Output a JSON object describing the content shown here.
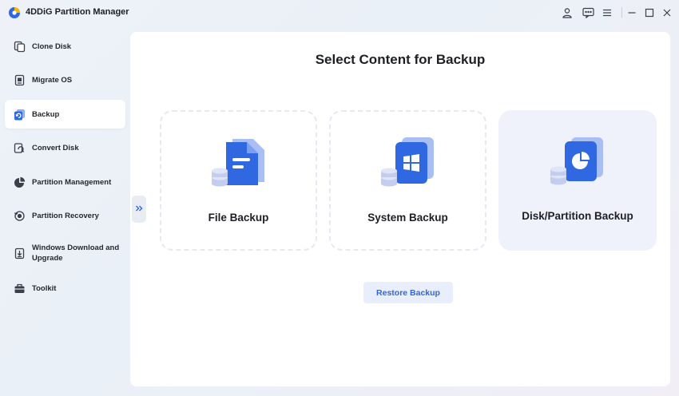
{
  "app": {
    "title": "4DDiG Partition Manager"
  },
  "titlebar": {
    "icons": [
      "account-icon",
      "feedback-icon",
      "menu-icon",
      "minimize-icon",
      "maximize-icon",
      "close-icon"
    ]
  },
  "sidebar": {
    "items": [
      {
        "label": "Clone Disk",
        "icon": "clone-disk-icon",
        "active": false
      },
      {
        "label": "Migrate OS",
        "icon": "migrate-os-icon",
        "active": false
      },
      {
        "label": "Backup",
        "icon": "backup-icon",
        "active": true
      },
      {
        "label": "Convert Disk",
        "icon": "convert-disk-icon",
        "active": false
      },
      {
        "label": "Partition Management",
        "icon": "partition-management-icon",
        "active": false
      },
      {
        "label": "Partition Recovery",
        "icon": "partition-recovery-icon",
        "active": false
      },
      {
        "label": "Windows Download and Upgrade",
        "icon": "windows-download-icon",
        "active": false
      },
      {
        "label": "Toolkit",
        "icon": "toolkit-icon",
        "active": false
      }
    ]
  },
  "main": {
    "title": "Select Content for Backup",
    "cards": [
      {
        "label": "File Backup",
        "icon": "file-backup-icon",
        "selected": false
      },
      {
        "label": "System Backup",
        "icon": "system-backup-icon",
        "selected": false
      },
      {
        "label": "Disk/Partition Backup",
        "icon": "disk-partition-backup-icon",
        "selected": true
      }
    ],
    "restore_label": "Restore Backup"
  },
  "colors": {
    "accent": "#2f68e0",
    "active_nav_icon": "#2d6be4",
    "selected_card_bg": "#eff2fb"
  }
}
